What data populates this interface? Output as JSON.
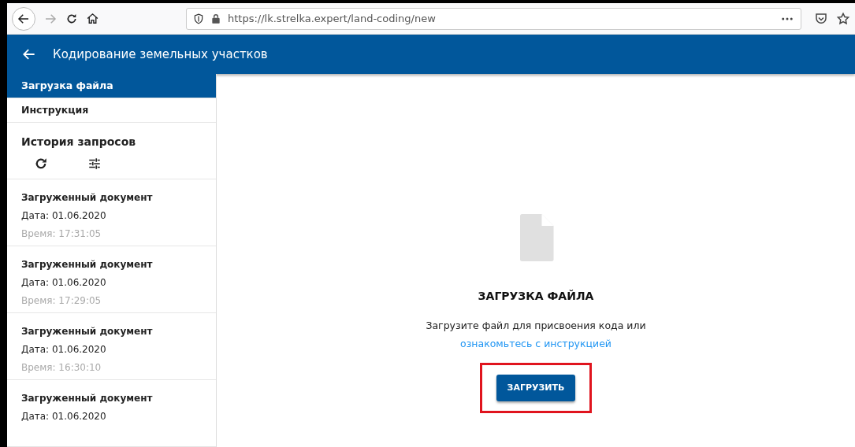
{
  "browser": {
    "url": "https://lk.strelka.expert/land-coding/new",
    "back_enabled": true,
    "forward_enabled": false
  },
  "header": {
    "title": "Кодирование земельных участков"
  },
  "sidebar": {
    "items": [
      {
        "label": "Загрузка файла",
        "selected": true
      },
      {
        "label": "Инструкция",
        "selected": false
      }
    ],
    "history": {
      "title": "История запросов",
      "documents": [
        {
          "title": "Загруженный документ",
          "date": "Дата: 01.06.2020",
          "time": "Время: 17:31:05"
        },
        {
          "title": "Загруженный документ",
          "date": "Дата: 01.06.2020",
          "time": "Время: 17:29:05"
        },
        {
          "title": "Загруженный документ",
          "date": "Дата: 01.06.2020",
          "time": "Время: 16:30:10"
        },
        {
          "title": "Загруженный документ",
          "date": "Дата: 01.06.2020"
        }
      ]
    }
  },
  "main": {
    "heading": "ЗАГРУЗКА ФАЙЛА",
    "text": "Загрузите файл для присвоения кода или",
    "link": "ознакомьтесь с инструкцией",
    "button": {
      "label": "ЗАГРУЗИТЬ",
      "highlighted": true
    }
  }
}
